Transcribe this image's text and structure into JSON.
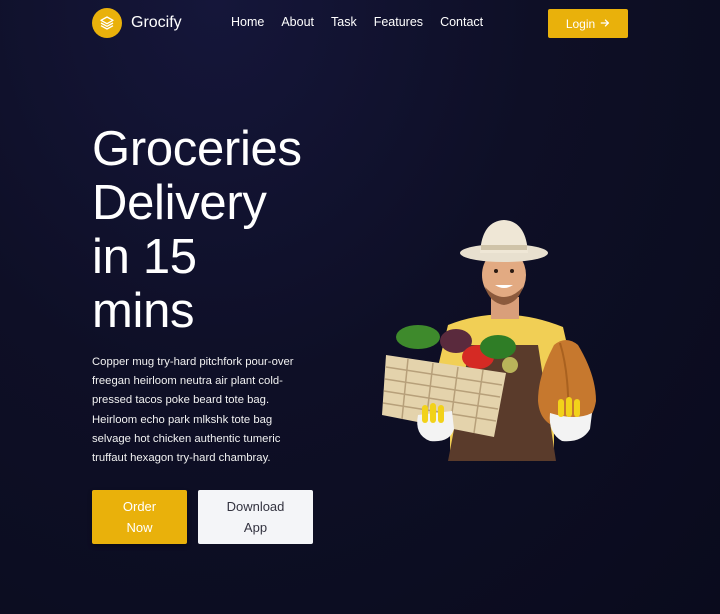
{
  "brand": {
    "name": "Grocify",
    "accent": "#e9b10b",
    "icon": "layers-icon"
  },
  "nav": {
    "items": [
      {
        "label": "Home"
      },
      {
        "label": "About"
      },
      {
        "label": "Task"
      },
      {
        "label": "Features"
      },
      {
        "label": "Contact"
      }
    ],
    "login_label": "Login",
    "login_icon": "arrow-right-icon"
  },
  "hero": {
    "title_lines": [
      "Groceries",
      "Delivery",
      "in 15",
      "mins"
    ],
    "description_lines": [
      "Copper mug try-hard pitchfork pour-over",
      "freegan heirloom neutra air plant cold-",
      "pressed tacos poke beard tote bag.",
      "Heirloom echo park mlkshk tote bag",
      "selvage hot chicken authentic tumeric",
      "truffaut hexagon try-hard chambray."
    ],
    "order_button": {
      "line1": "Order",
      "line2": "Now"
    },
    "download_button": {
      "line1": "Download",
      "line2": "App"
    },
    "image": "farmer-with-vegetable-basket-image"
  },
  "colors": {
    "background": "#0e0f26",
    "text": "#ffffff",
    "secondary_button": "#f4f5f8"
  }
}
